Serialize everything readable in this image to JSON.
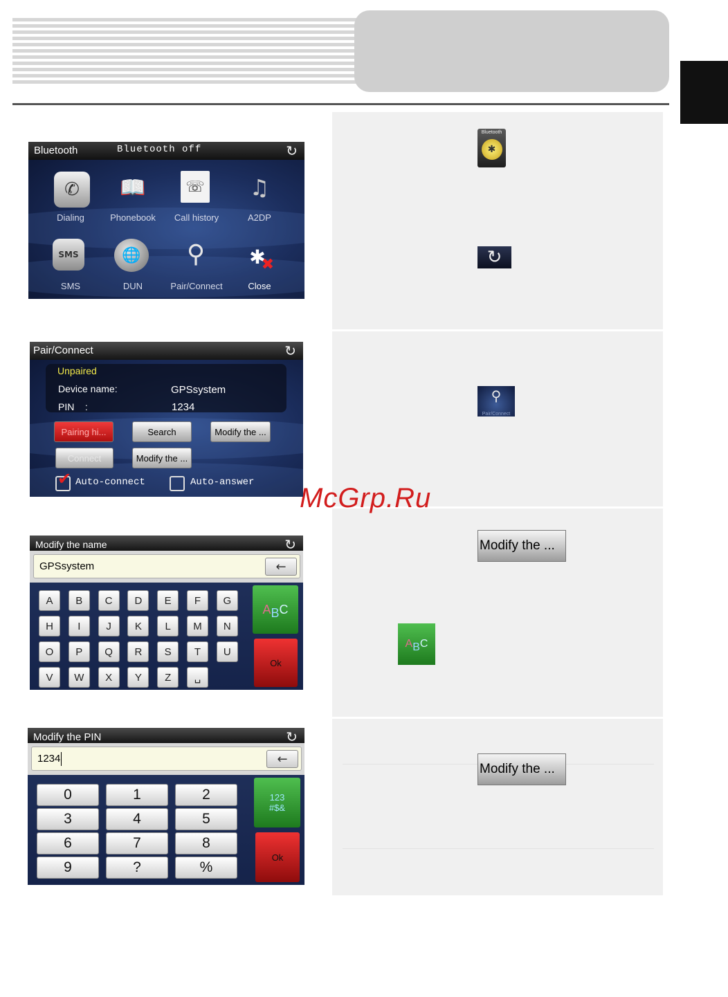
{
  "bt_menu": {
    "title": "Bluetooth",
    "status": "Bluetooth off",
    "items": [
      {
        "label": "Dialing"
      },
      {
        "label": "Phonebook"
      },
      {
        "label": "Call history"
      },
      {
        "label": "A2DP"
      },
      {
        "label": "SMS"
      },
      {
        "label": "DUN"
      },
      {
        "label": "Pair/Connect"
      },
      {
        "label": "Close"
      }
    ]
  },
  "pair": {
    "title": "Pair/Connect",
    "state": "Unpaired",
    "device_label": "Device name:",
    "device_value": "GPSsystem",
    "pin_label": "PIN    :",
    "pin_value": "1234",
    "btn_history": "Pairing hi...",
    "btn_search": "Search",
    "btn_modify_name": "Modify the ...",
    "btn_connect": "Connect",
    "btn_modify_pin": "Modify the ...",
    "auto_connect": "Auto-connect",
    "auto_answer": "Auto-answer"
  },
  "name_kb": {
    "title": "Modify the name",
    "value": "GPSsystem",
    "rows": [
      [
        "A",
        "B",
        "C",
        "D",
        "E",
        "F",
        "G"
      ],
      [
        "H",
        "I",
        "J",
        "K",
        "L",
        "M",
        "N"
      ],
      [
        "O",
        "P",
        "Q",
        "R",
        "S",
        "T",
        "U"
      ],
      [
        "V",
        "W",
        "X",
        "Y",
        "Z",
        "␣"
      ]
    ],
    "mode_a": "A",
    "mode_b": "B",
    "mode_c": "C",
    "ok": "Ok"
  },
  "pin_kb": {
    "title": "Modify the PIN",
    "value": "1234",
    "rows": [
      [
        "0",
        "1",
        "2"
      ],
      [
        "3",
        "4",
        "5"
      ],
      [
        "6",
        "7",
        "8"
      ],
      [
        "9",
        "?",
        "%"
      ]
    ],
    "mode_top": "123",
    "mode_bottom": "#$&",
    "ok": "Ok"
  },
  "right": {
    "bt_icon_label": "Bluetooth",
    "pair_icon_label": "Pair/Connect",
    "modify_btn_1": "Modify the ...",
    "modify_btn_2": "Modify the ...",
    "abc_a": "A",
    "abc_b": "B",
    "abc_c": "C"
  },
  "watermark": "McGrp.Ru",
  "colors": {
    "accent_yellow": "#f2e84a",
    "red": "#d21d1d",
    "green": "#2e9a2e"
  }
}
